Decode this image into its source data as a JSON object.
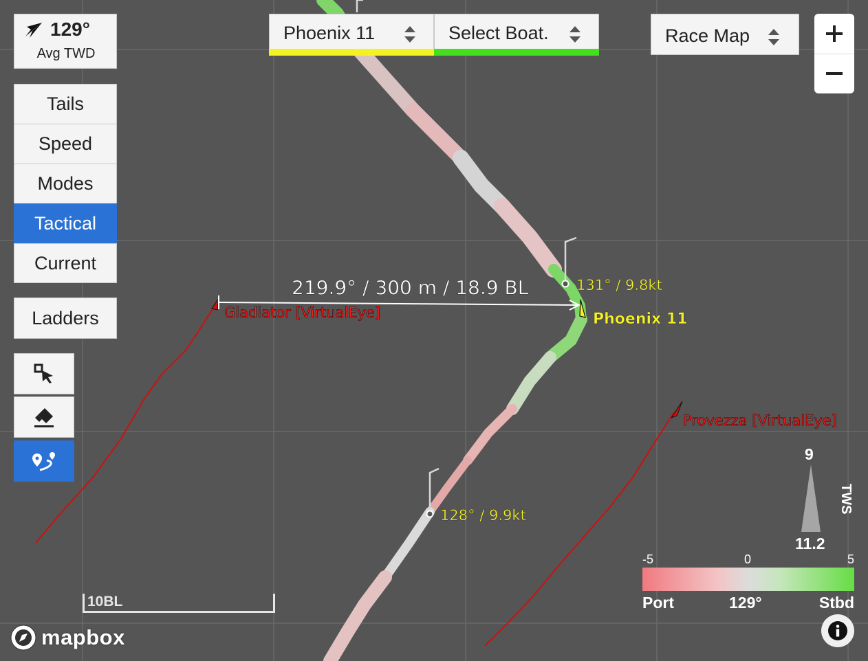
{
  "wind": {
    "value": "129°",
    "label": "Avg TWD"
  },
  "modes": [
    {
      "name": "mode-tails",
      "label": "Tails",
      "active": false
    },
    {
      "name": "mode-speed",
      "label": "Speed",
      "active": false
    },
    {
      "name": "mode-modes",
      "label": "Modes",
      "active": false
    },
    {
      "name": "mode-tactical",
      "label": "Tactical",
      "active": true
    },
    {
      "name": "mode-current",
      "label": "Current",
      "active": false
    }
  ],
  "ladders_label": "Ladders",
  "tools": [
    {
      "icon": "select-area-icon",
      "active": false
    },
    {
      "icon": "eraser-icon",
      "active": false
    },
    {
      "icon": "route-measure-icon",
      "active": true
    }
  ],
  "boat_select_1": {
    "value": "Phoenix 11",
    "color": "#f5f224"
  },
  "boat_select_2": {
    "value": "Select Boat.",
    "color": "#44e01e"
  },
  "map_select": {
    "value": "Race Map"
  },
  "zoom": {
    "in_icon": "plus-icon",
    "out_icon": "minus-icon"
  },
  "map": {
    "measurement": "219.9° / 300 m / 18.9 BL",
    "label_gladiator": "Gladiator [VirtualEye]",
    "label_phoenix": "Phoenix 11",
    "label_provezza": "Provezza [VirtualEye]",
    "wind_label_1": "131° / 9.8kt",
    "wind_label_2": "128° / 9.9kt",
    "colors": {
      "red_track": "#cc1111",
      "label_red": "#ff1f1f",
      "label_yellow": "#f5f224"
    }
  },
  "tws": {
    "top": "9",
    "bottom": "11.2",
    "label": "TWS"
  },
  "legend": {
    "ticks": [
      "-5",
      "0",
      "5"
    ],
    "left_label": "Port",
    "center_label": "129°",
    "right_label": "Stbd"
  },
  "scale_label": "10BL",
  "attribution": "mapbox"
}
